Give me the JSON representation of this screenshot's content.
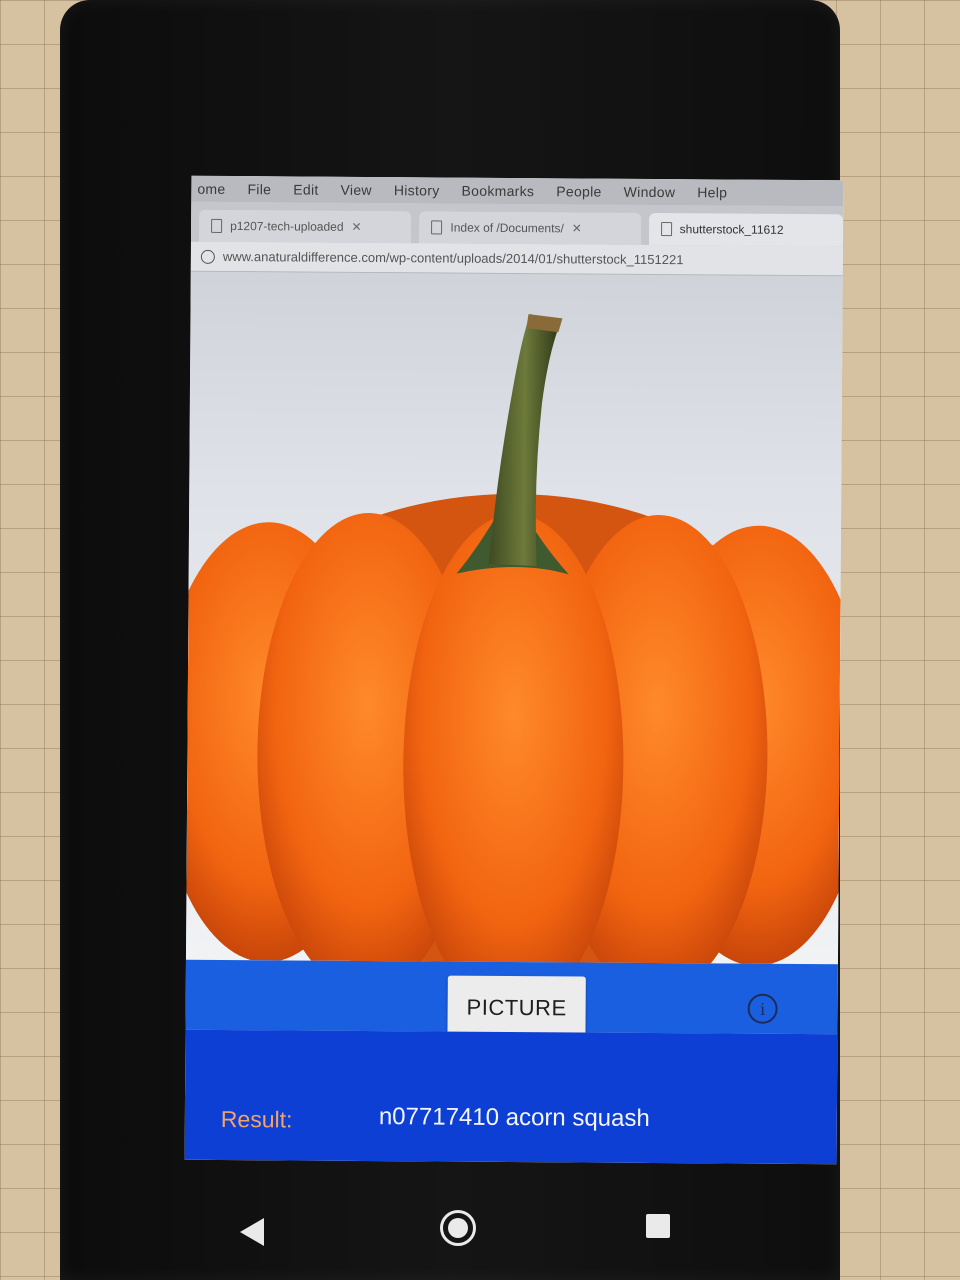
{
  "browser": {
    "menu": [
      "ome",
      "File",
      "Edit",
      "View",
      "History",
      "Bookmarks",
      "People",
      "Window",
      "Help"
    ],
    "tabs": [
      {
        "label": "p1207-tech-uploaded"
      },
      {
        "label": "Index of /Documents/"
      },
      {
        "label": "shutterstock_11612"
      }
    ],
    "address": "www.anaturaldifference.com/wp-content/uploads/2014/01/shutterstock_1151221"
  },
  "app": {
    "picture_button": "PICTURE",
    "info_icon": "info-icon",
    "result_label": "Result:",
    "result_value": "n07717410 acorn squash",
    "colors": {
      "controls_bar": "#1a5fe0",
      "result_panel": "#0d3fd4",
      "result_label": "#f2a466"
    }
  },
  "navigation": {
    "back_icon": "back-triangle-icon",
    "home_icon": "home-circle-icon",
    "recents_icon": "recents-square-icon"
  }
}
